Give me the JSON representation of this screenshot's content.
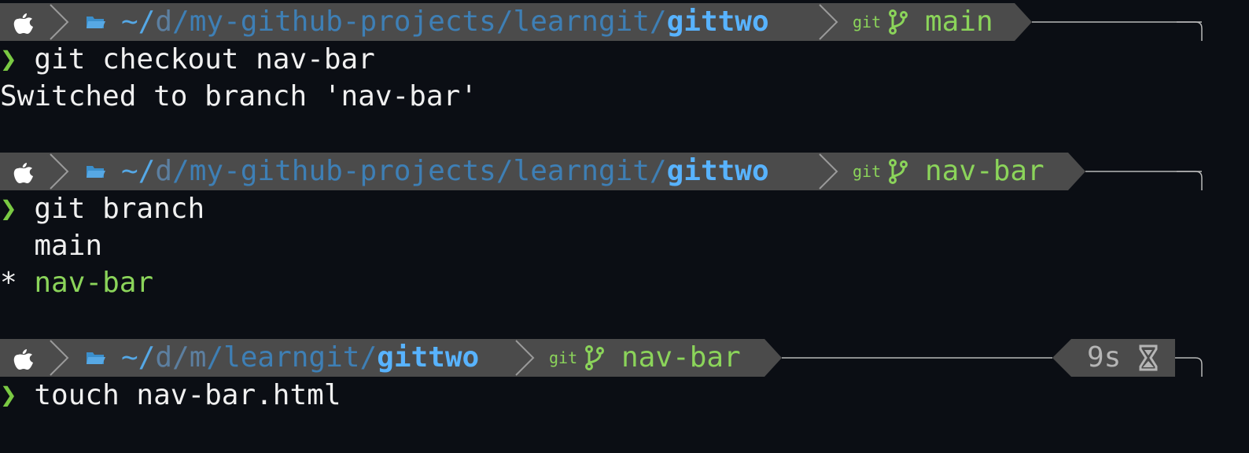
{
  "colors": {
    "background": "#0b0e14",
    "prompt_bar": "#4b4b4b",
    "path": "#3e7fb5",
    "repo": "#58b3ff",
    "branch": "#8bd45a",
    "caret": "#7ac943"
  },
  "icons": {
    "os": "apple-icon",
    "folder": "folder-icon",
    "vcs": "git-icon",
    "branch": "git-branch-icon",
    "timer": "hourglass-icon",
    "prompt": "chevron-right-icon"
  },
  "prompts": [
    {
      "path_tilde": "~/",
      "path_parts": [
        "d",
        "/my-github-projects/learngit/"
      ],
      "repo": "gittwo",
      "git_label": "git",
      "branch": "main",
      "command": "git checkout nav-bar",
      "output": [
        "Switched to branch 'nav-bar'"
      ]
    },
    {
      "path_tilde": "~/",
      "path_parts": [
        "d",
        "/my-github-projects/learngit/"
      ],
      "repo": "gittwo",
      "git_label": "git",
      "branch": "nav-bar",
      "command": "git branch",
      "output_lines": [
        {
          "marker": " ",
          "name": "main"
        },
        {
          "marker": "*",
          "name": "nav-bar"
        }
      ]
    },
    {
      "path_tilde": "~/",
      "path_parts": [
        "d/m",
        "/learngit/"
      ],
      "repo": "gittwo",
      "git_label": "git",
      "branch": "nav-bar",
      "duration": "9s",
      "command": "touch nav-bar.html"
    }
  ],
  "caret_glyph": "❯"
}
